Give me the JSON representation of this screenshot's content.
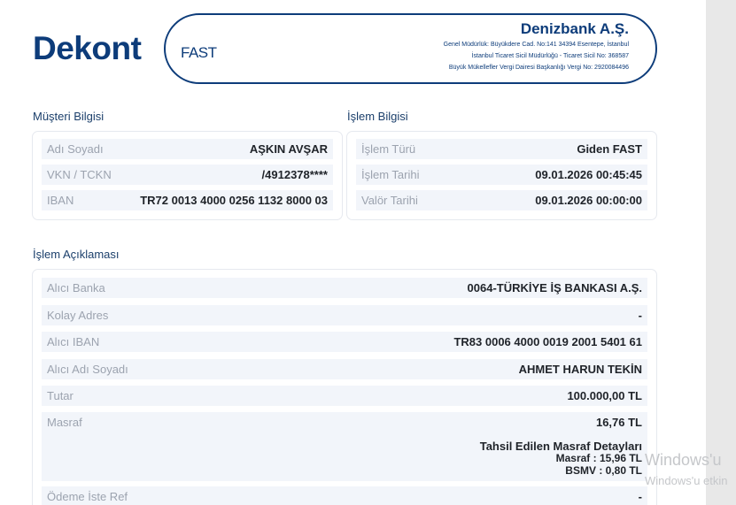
{
  "header": {
    "logo": "Dekont",
    "type": "FAST",
    "bank_name": "Denizbank A.Ş.",
    "bank_lines": [
      "Genel Müdürlük: Büyükdere Cad. No:141 34394 Esentepe, İstanbul",
      "İstanbul Ticaret Sicil Müdürlüğü - Ticaret Sicil No: 368587",
      "Büyük Mükellefler Vergi Dairesi Başkanlığı Vergi No: 2920084496"
    ]
  },
  "customer": {
    "title": "Müşteri Bilgisi",
    "rows": [
      {
        "label": "Adı Soyadı",
        "value": "AŞKIN AVŞAR"
      },
      {
        "label": "VKN / TCKN",
        "value": "/4912378****"
      },
      {
        "label": "IBAN",
        "value": "TR72 0013 4000 0256 1132 8000 03"
      }
    ]
  },
  "transaction": {
    "title": "İşlem Bilgisi",
    "rows": [
      {
        "label": "İşlem Türü",
        "value": "Giden FAST"
      },
      {
        "label": "İşlem Tarihi",
        "value": "09.01.2026 00:45:45"
      },
      {
        "label": "Valör Tarihi",
        "value": "09.01.2026 00:00:00"
      }
    ]
  },
  "description": {
    "title": "İşlem Açıklaması",
    "rows": [
      {
        "label": "Alıcı Banka",
        "value": "0064-TÜRKİYE İŞ BANKASI A.Ş."
      },
      {
        "label": "Kolay Adres",
        "value": "-"
      },
      {
        "label": "Alıcı IBAN",
        "value": "TR83 0006 4000 0019 2001 5401 61"
      },
      {
        "label": "Alıcı Adı Soyadı",
        "value": "AHMET HARUN TEKİN"
      },
      {
        "label": "Tutar",
        "value": "100.000,00 TL"
      }
    ],
    "fee": {
      "label": "Masraf",
      "value": "16,76 TL",
      "detail_title": "Tahsil Edilen Masraf Detayları",
      "details": [
        {
          "key": "Masraf",
          "value": ": 15,96 TL"
        },
        {
          "key": "BSMV",
          "value": ": 0,80 TL"
        }
      ]
    },
    "last_row": {
      "label": "Ödeme İste Ref",
      "value": "-"
    }
  },
  "watermark": {
    "line1": "Windows'u",
    "line2": "Windows'u etkin"
  }
}
